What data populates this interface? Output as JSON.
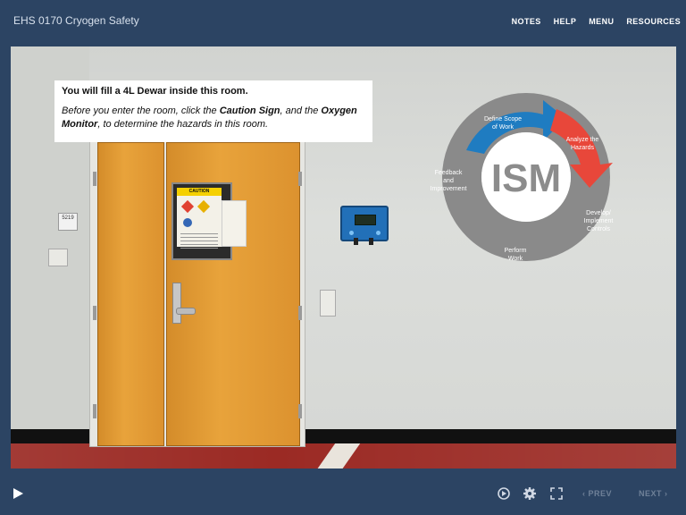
{
  "header": {
    "course_title": "EHS 0170 Cryogen Safety",
    "nav": [
      {
        "label": "NOTES"
      },
      {
        "label": "HELP"
      },
      {
        "label": "MENU"
      },
      {
        "label": "RESOURCES"
      }
    ]
  },
  "slide": {
    "instruction": {
      "headline": "You will fill a 4L Dewar inside this room.",
      "body_part1": "Before you enter the room, click the ",
      "caution_sign_text": "Caution Sign",
      "body_part2": ", and the ",
      "oxygen_monitor_text": "Oxygen Monitor",
      "body_part3": ", to determine the hazards in this room."
    },
    "room_number": "5219",
    "caution_sign_label": "CAUTION",
    "ism": {
      "center": "ISM",
      "steps": [
        {
          "line1": "Define Scope",
          "line2": "of Work",
          "line3": "",
          "color": "#1f7cc1"
        },
        {
          "line1": "Analyze the",
          "line2": "Hazards",
          "line3": "",
          "color": "#e8473a"
        },
        {
          "line1": "Develop/",
          "line2": "Implement",
          "line3": "Controls",
          "color": "#8a8a8a"
        },
        {
          "line1": "Perform",
          "line2": "Work",
          "line3": "",
          "color": "#8a8a8a"
        },
        {
          "line1": "Feedback",
          "line2": "and",
          "line3": "Improvement",
          "color": "#8a8a8a"
        }
      ]
    }
  },
  "footer": {
    "prev_label": "PREV",
    "next_label": "NEXT",
    "icons": [
      "play-icon",
      "replay-icon",
      "settings-gear-icon",
      "fullscreen-icon",
      "chevron-left-icon",
      "chevron-right-icon"
    ]
  },
  "colors": {
    "background": "#2c4463",
    "accent_blue": "#1f7cc1",
    "accent_red": "#e8473a",
    "ism_gray": "#8a8a8a"
  }
}
